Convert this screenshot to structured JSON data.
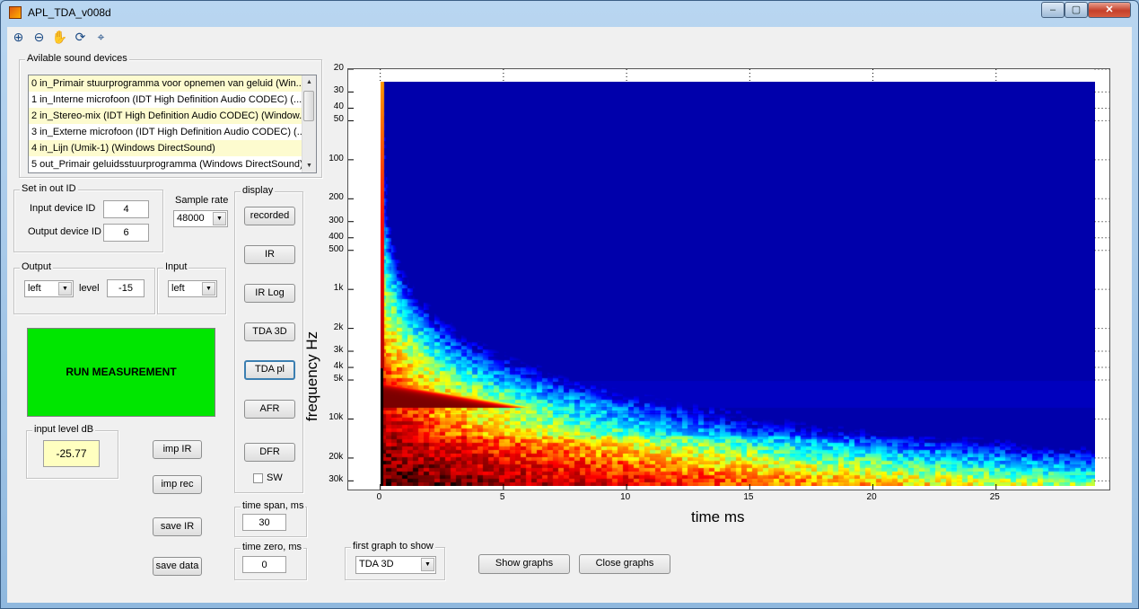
{
  "window": {
    "title": "APL_TDA_v008d",
    "minimize": "‒",
    "maximize": "▢",
    "close": "✕"
  },
  "toolbar": [
    {
      "name": "zoom-in-icon",
      "glyph": "⊕"
    },
    {
      "name": "zoom-out-icon",
      "glyph": "⊖"
    },
    {
      "name": "pan-hand-icon",
      "glyph": "✋"
    },
    {
      "name": "rotate-3d-icon",
      "glyph": "⟳"
    },
    {
      "name": "data-cursor-icon",
      "glyph": "⌖"
    }
  ],
  "devices": {
    "label": "Avilable sound devices",
    "items": [
      "0 in_Primair stuurprogramma voor opnemen van geluid (Win...",
      "1 in_Interne microfoon (IDT High Definition Audio CODEC) (...",
      "2 in_Stereo-mix (IDT High Definition Audio CODEC) (Window...",
      "3 in_Externe microfoon (IDT High Definition Audio CODEC) (...",
      "4 in_Lijn (Umik-1) (Windows DirectSound)",
      "5 out_Primair geluidsstuurprogramma (Windows DirectSound)"
    ]
  },
  "inout": {
    "label": "Set in out ID",
    "input_label": "Input device ID",
    "input_value": "4",
    "output_label": "Output device ID",
    "output_value": "6"
  },
  "samplerate": {
    "label": "Sample rate",
    "value": "48000"
  },
  "output": {
    "label": "Output",
    "channel": "left",
    "level_label": "level",
    "level": "-15"
  },
  "input": {
    "label": "Input",
    "channel": "left"
  },
  "run": {
    "label": "RUN MEASUREMENT"
  },
  "input_level": {
    "label": "input level dB",
    "value": "-25.77"
  },
  "actions": {
    "imp_ir": "imp IR",
    "imp_rec": "imp rec",
    "save_ir": "save IR",
    "save_data": "save data"
  },
  "display": {
    "label": "display",
    "buttons": [
      "recorded",
      "IR",
      "IR Log",
      "TDA 3D",
      "TDA pl",
      "AFR",
      "DFR"
    ],
    "sw_label": "SW"
  },
  "timespan": {
    "label": "time span, ms",
    "value": "30"
  },
  "timezero": {
    "label": "time zero, ms",
    "value": "0"
  },
  "firstgraph": {
    "label": "first graph to show",
    "value": "TDA 3D"
  },
  "graphs": {
    "show": "Show graphs",
    "close": "Close graphs"
  },
  "chart_data": {
    "type": "heatmap",
    "title": "",
    "xlabel": "time   ms",
    "ylabel": "frequency   Hz",
    "xlim": [
      -1.3,
      29.6
    ],
    "ylim": [
      20,
      35000
    ],
    "yscale": "log",
    "grid": true,
    "data_x_range": [
      0,
      29
    ],
    "data_y_range": [
      25,
      33000
    ],
    "x_ticks": [
      0,
      5,
      10,
      15,
      20,
      25
    ],
    "x_tick_labels": [
      "0",
      "5",
      "10",
      "15",
      "20",
      "25"
    ],
    "y_ticks": [
      20,
      30,
      40,
      50,
      100,
      200,
      300,
      400,
      500,
      1000,
      2000,
      3000,
      4000,
      5000,
      10000,
      20000,
      30000
    ],
    "y_tick_labels": [
      "20",
      "30",
      "40",
      "50",
      "100",
      "200",
      "300",
      "400",
      "500",
      "1k",
      "2k",
      "3k",
      "4k",
      "5k",
      "10k",
      "20k",
      "30k"
    ],
    "colormap": [
      "#00008f",
      "#0000ff",
      "#00ffff",
      "#ffff00",
      "#ff0000",
      "#800000",
      "#000000"
    ]
  }
}
